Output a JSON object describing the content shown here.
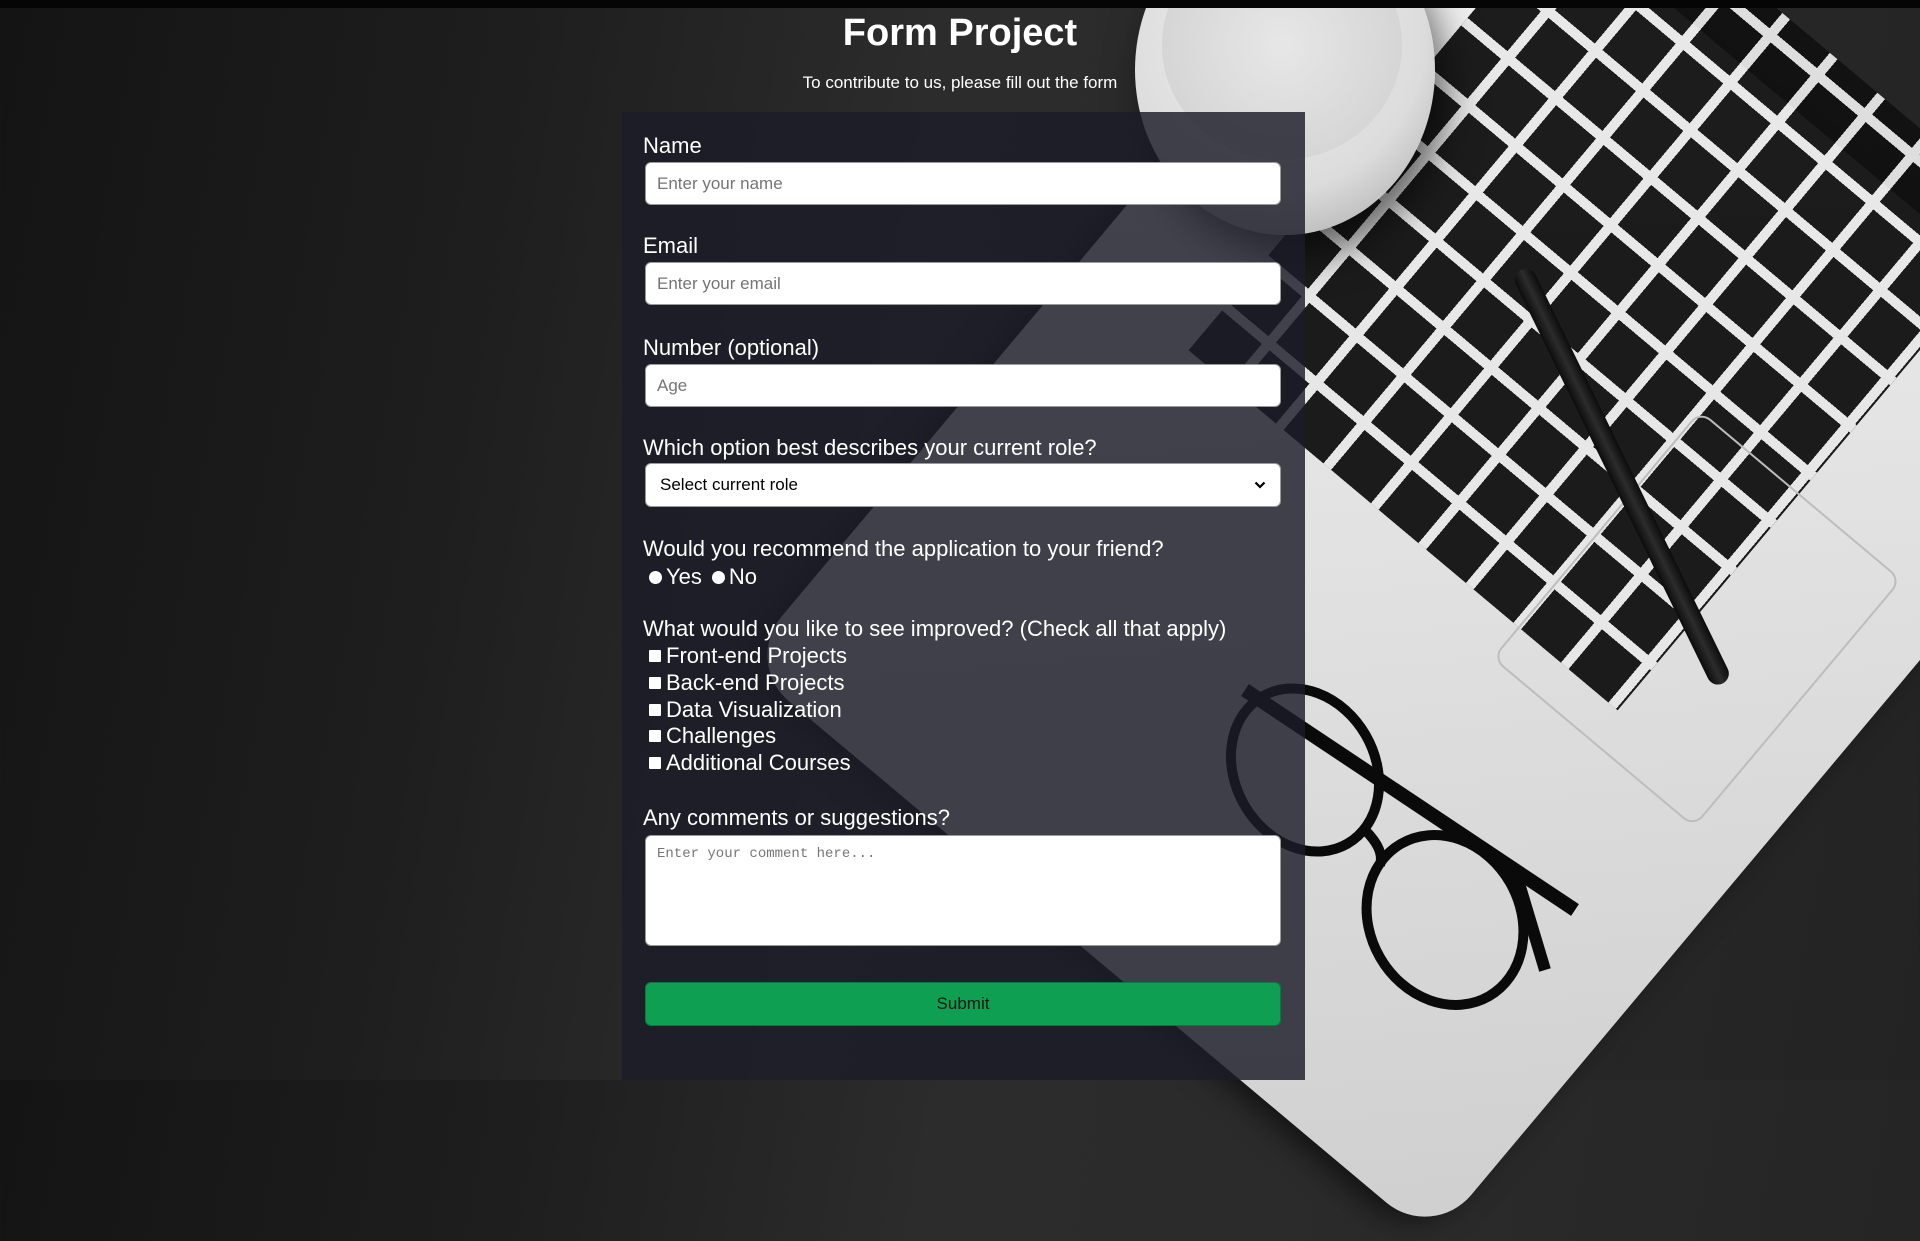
{
  "header": {
    "title": "Form Project",
    "subtitle": "To contribute to us, please fill out the form"
  },
  "form": {
    "name": {
      "label": "Name",
      "placeholder": "Enter your name",
      "value": ""
    },
    "email": {
      "label": "Email",
      "placeholder": "Enter your email",
      "value": ""
    },
    "number": {
      "label": "Number (optional)",
      "placeholder": "Age",
      "value": ""
    },
    "role": {
      "label": "Which option best describes your current role?",
      "selected": "Select current role"
    },
    "recommend": {
      "label": "Would you recommend the application to your friend?",
      "options": [
        "Yes",
        "No"
      ],
      "selected": null
    },
    "improve": {
      "label": "What would you like to see improved? (Check all that apply)",
      "options": [
        "Front-end Projects",
        "Back-end Projects",
        "Data Visualization",
        "Challenges",
        "Additional Courses"
      ],
      "checked": []
    },
    "comments": {
      "label": "Any comments or suggestions?",
      "placeholder": "Enter your comment here...",
      "value": ""
    },
    "submit_label": "Submit"
  },
  "colors": {
    "submit": "#0e9f53",
    "panel": "#1c1c28",
    "text": "#ffffff"
  }
}
